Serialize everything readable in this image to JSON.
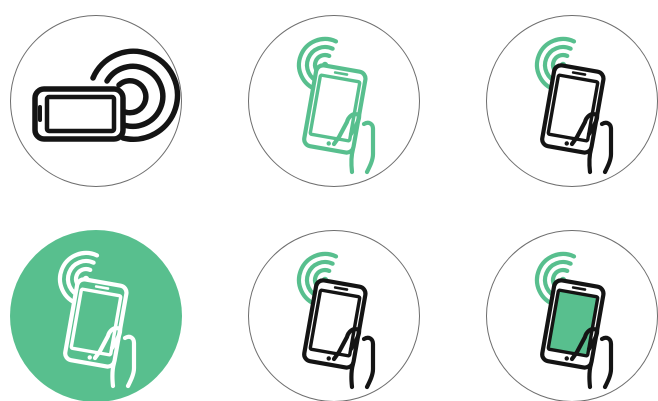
{
  "title": "",
  "colors": {
    "accent": "#58bf8e",
    "ink": "#141414",
    "circle_border": "#6e6e6e",
    "background": "#ffffff"
  },
  "badges": [
    {
      "icon": "phone-landscape-nfc-icon",
      "style": "outline",
      "waves": "#141414",
      "phone": "#141414",
      "hand": null,
      "screen_fill": null
    },
    {
      "icon": "hand-phone-tap-icon",
      "style": "outline",
      "waves": "#58bf8e",
      "phone": "#58bf8e",
      "hand": "#58bf8e",
      "screen_fill": null
    },
    {
      "icon": "hand-phone-tap-icon",
      "style": "outline",
      "waves": "#58bf8e",
      "phone": "#141414",
      "hand": "#141414",
      "screen_fill": null
    },
    {
      "icon": "hand-phone-tap-icon",
      "style": "filled",
      "waves": "#ffffff",
      "phone": "#ffffff",
      "hand": "#ffffff",
      "screen_fill": null,
      "background": "#58bf8e"
    },
    {
      "icon": "hand-phone-tap-icon",
      "style": "outline",
      "waves": "#58bf8e",
      "phone": "#141414",
      "hand": "#141414",
      "screen_fill": null
    },
    {
      "icon": "hand-phone-tap-icon",
      "style": "outline",
      "waves": "#58bf8e",
      "phone": "#141414",
      "hand": "#141414",
      "screen_fill": "#58bf8e"
    }
  ]
}
